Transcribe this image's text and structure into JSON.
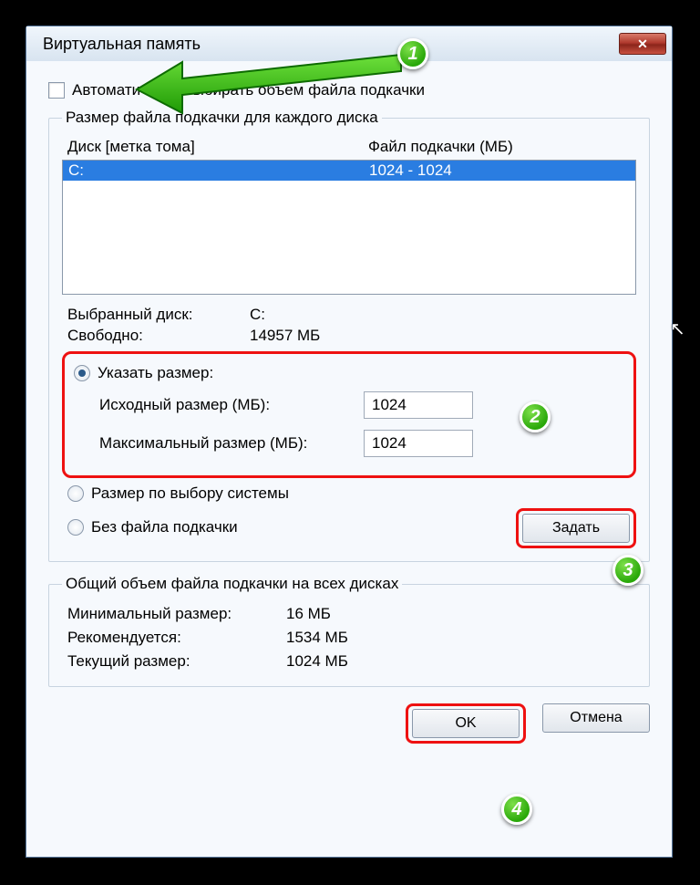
{
  "title": "Виртуальная память",
  "auto_checkbox_label": "Автоматически выбирать объем файла подкачки",
  "group_each": "Размер файла подкачки для каждого диска",
  "col_disk": "Диск [метка тома]",
  "col_pagefile": "Файл подкачки (МБ)",
  "disk_list": [
    {
      "drive": "C:",
      "size": "1024 - 1024"
    }
  ],
  "selected_disk_label": "Выбранный диск:",
  "selected_disk_value": "C:",
  "free_label": "Свободно:",
  "free_value": "14957 МБ",
  "radio_custom": "Указать размер:",
  "initial_label": "Исходный размер (МБ):",
  "initial_value": "1024",
  "max_label": "Максимальный размер (МБ):",
  "max_value": "1024",
  "radio_system": "Размер по выбору системы",
  "radio_none": "Без файла подкачки",
  "set_button": "Задать",
  "group_total": "Общий объем файла подкачки на всех дисках",
  "min_label": "Минимальный размер:",
  "min_value": "16 МБ",
  "rec_label": "Рекомендуется:",
  "rec_value": "1534 МБ",
  "cur_label": "Текущий размер:",
  "cur_value": "1024 МБ",
  "ok_button": "OK",
  "cancel_button": "Отмена",
  "badges": {
    "b1": "1",
    "b2": "2",
    "b3": "3",
    "b4": "4"
  }
}
